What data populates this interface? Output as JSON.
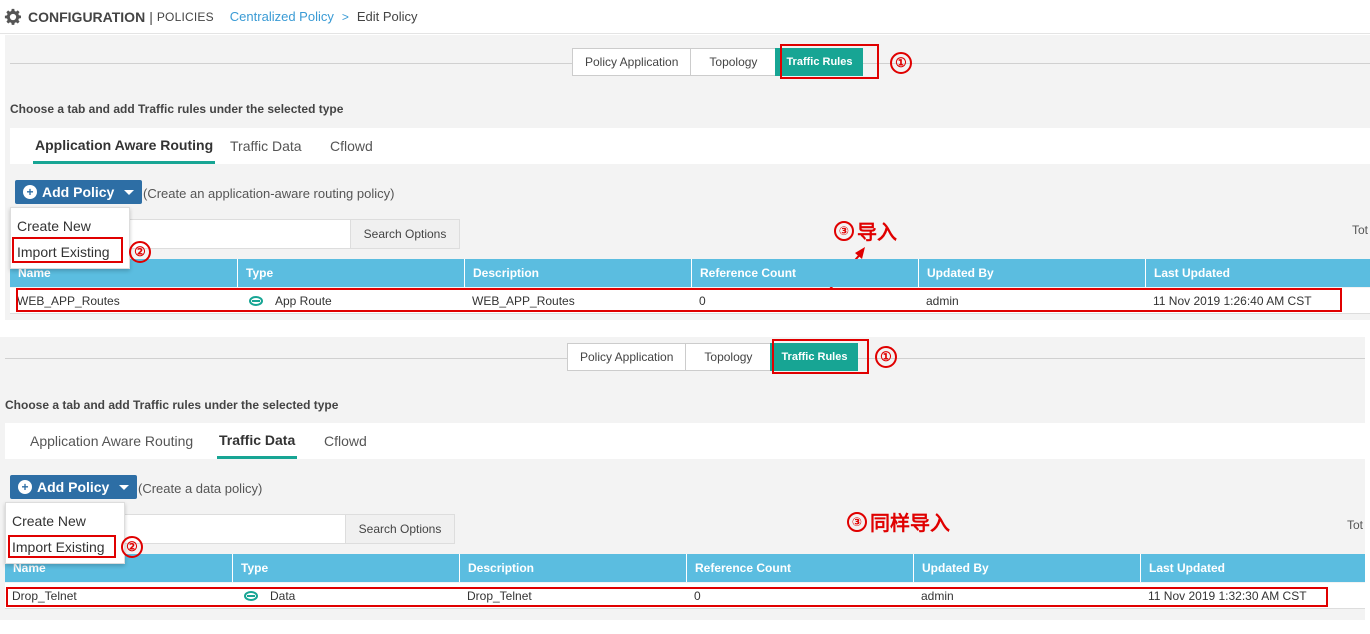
{
  "header": {
    "section": "CONFIGURATION",
    "separator": "|",
    "subsection": "POLICIES",
    "breadcrumb_link": "Centralized Policy",
    "breadcrumb_sep": ">",
    "breadcrumb_current": "Edit Policy"
  },
  "colors": {
    "accent_teal": "#17a594",
    "table_header": "#5bbde0",
    "primary_button": "#2d6ea5",
    "annotation_red": "#e00000",
    "link": "#3a9bd5"
  },
  "panels": [
    {
      "segments": [
        "Policy Application",
        "Topology",
        "Traffic Rules"
      ],
      "active_segment": "Traffic Rules",
      "marker_segment": "①",
      "help": "Choose a tab and add Traffic rules under the selected type",
      "tabs": [
        "Application Aware Routing",
        "Traffic Data",
        "Cflowd"
      ],
      "active_tab": "Application Aware Routing",
      "add_button": "Add Policy",
      "add_hint": "(Create an application-aware routing policy)",
      "search_options": "Search Options",
      "total_label": "Tot",
      "dropdown": [
        "Create New",
        "Import Existing"
      ],
      "marker_dropdown": "②",
      "annotation": {
        "circle": "③",
        "text": "导入"
      },
      "columns": [
        "Name",
        "Type",
        "Description",
        "Reference Count",
        "Updated By",
        "Last Updated"
      ],
      "rows": [
        {
          "name": "WEB_APP_Routes",
          "type": "App Route",
          "description": "WEB_APP_Routes",
          "reference_count": "0",
          "updated_by": "admin",
          "last_updated": "11 Nov 2019 1:26:40 AM CST"
        }
      ]
    },
    {
      "segments": [
        "Policy Application",
        "Topology",
        "Traffic Rules"
      ],
      "active_segment": "Traffic Rules",
      "marker_segment": "①",
      "help": "Choose a tab and add Traffic rules under the selected type",
      "tabs": [
        "Application Aware Routing",
        "Traffic Data",
        "Cflowd"
      ],
      "active_tab": "Traffic Data",
      "add_button": "Add Policy",
      "add_hint": "(Create a data policy)",
      "search_options": "Search Options",
      "total_label": "Tot",
      "dropdown": [
        "Create New",
        "Import Existing"
      ],
      "marker_dropdown": "②",
      "annotation": {
        "circle": "③",
        "text": "同样导入"
      },
      "columns": [
        "Name",
        "Type",
        "Description",
        "Reference Count",
        "Updated By",
        "Last Updated"
      ],
      "rows": [
        {
          "name": "Drop_Telnet",
          "type": "Data",
          "description": "Drop_Telnet",
          "reference_count": "0",
          "updated_by": "admin",
          "last_updated": "11 Nov 2019 1:32:30 AM CST"
        }
      ]
    }
  ]
}
